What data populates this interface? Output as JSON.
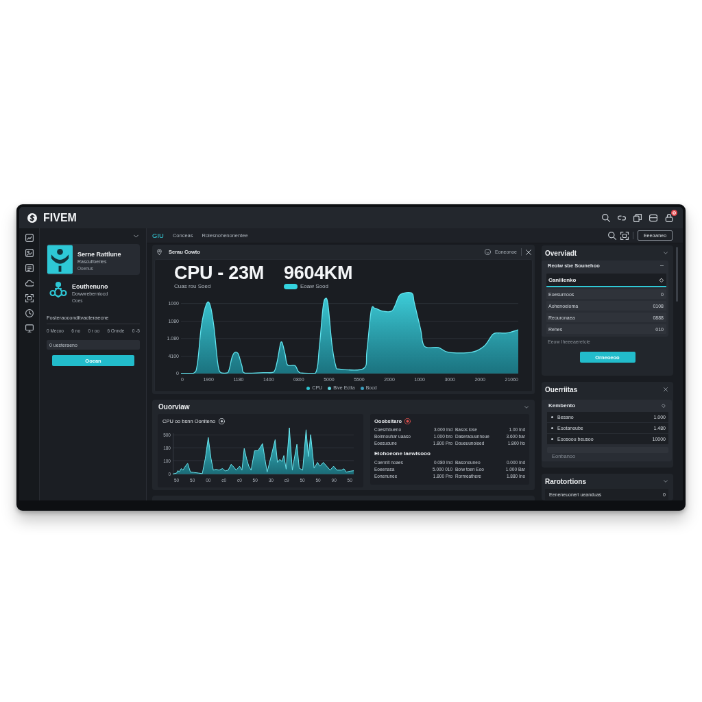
{
  "topbar": {
    "brand": "FIVEM",
    "alert": true
  },
  "left_panel": {
    "servers": [
      {
        "name": "Serne Rattlune",
        "detail": "Rasculfoeries",
        "status": "Ooenus",
        "selected": true
      },
      {
        "name": "Eouthenuno",
        "detail": "Dowwreberniocd",
        "status": "Ooes",
        "selected": false
      }
    ],
    "section_label": "Fosteraoconditvacteraecne",
    "stats": [
      "0 Mecoo",
      "6 no",
      "0 r oo",
      "6 Onnde",
      "0 -5"
    ],
    "search": {
      "placeholder": "0 uesteraeno"
    },
    "button": "Ooean"
  },
  "tabs": [
    {
      "label": "GIU",
      "selected": true
    },
    {
      "label": "Conceas",
      "selected": false
    },
    {
      "label": "Rolesnohenonentee",
      "selected": false
    }
  ],
  "toolbar": {
    "button": "Eeeowneo"
  },
  "main_chart": {
    "title": "Serau Cowto",
    "action": "Eoneonoe",
    "headline": "CPU - 23M",
    "headline_caption": "Cuas rou Soed",
    "metric": "9604KM",
    "metric_caption": "Eoaw Sood",
    "y_labels": [
      "1000",
      "1080",
      "1.080",
      "4100",
      "0"
    ],
    "x_labels": [
      "0",
      "1900",
      "1180",
      "1400",
      "0800",
      "5000",
      "5500",
      "2000",
      "1000",
      "3000",
      "2000",
      "21060"
    ],
    "legend": [
      {
        "label": "CPU",
        "color": "#2ec5d3"
      },
      {
        "label": "Bive Ectta",
        "color": "#5ed6df"
      },
      {
        "label": "Bocd",
        "color": "#3b9fbf"
      }
    ]
  },
  "overview": {
    "title": "Ouorviaw",
    "chart": {
      "title": "CPU oo bsnn Ooniteno",
      "y_labels": [
        "500",
        "180",
        "100",
        "0"
      ],
      "x_labels": [
        "50",
        "50",
        "00",
        "c0",
        "c0",
        "50",
        "30",
        "c9",
        "50",
        "50",
        "90",
        "50"
      ]
    },
    "stats": {
      "title": "Ooobsitaro",
      "sections": [
        {
          "rows": [
            [
              "Coesrhbueno",
              "3.000 Ind",
              "Basos lose",
              "1.00 Ind"
            ],
            [
              "Boinnouhar uaaso",
              "1.000 bro",
              "Daseraouunnoue",
              "3.600 bar"
            ],
            [
              "Eoesuoune",
              "1.800 Pro",
              "Doueuunoioed",
              "1.800 Ito"
            ]
          ]
        },
        {
          "heading": "Elohoeone Iaewlsooo",
          "rows": [
            [
              "Coennlt noaes",
              "0.080 Ind",
              "Basonouneo",
              "0.000 Ind"
            ],
            [
              "Eoeenasa",
              "5.000 010",
              "Boiw toen Eoo",
              "1.000 Bar"
            ],
            [
              "Eonenunee",
              "1.800 Pro",
              "Rormeathere",
              "1.880 Ino"
            ]
          ]
        }
      ]
    }
  },
  "side_overview": {
    "title": "Overviadt",
    "group": "Reoiw sbe Sounehoo",
    "items": [
      {
        "label": "Caniilenko",
        "value": "◇",
        "selected": true
      },
      {
        "label": "Eoesurnoos",
        "value": "0",
        "selected": false
      },
      {
        "label": "Aohenoeioma",
        "value": "0108",
        "selected": false
      },
      {
        "label": "Reouronaea",
        "value": "0888",
        "selected": false
      },
      {
        "label": "Rehes",
        "value": "010",
        "selected": false
      }
    ],
    "note": "Eeow Iheeeaeretcie",
    "button": "Orneoeoo"
  },
  "metrics_panel": {
    "title": "Ouerriitas",
    "group": "Kembento",
    "items": [
      {
        "label": "Besano",
        "value": "1.000"
      },
      {
        "label": "Eootanoube",
        "value": "1.480"
      },
      {
        "label": "Eoosoou beusoo",
        "value": "10000"
      }
    ],
    "note": "Eonbanoo"
  },
  "reports_panel": {
    "title": "Rarotortions",
    "items": [
      {
        "label": "Eeneneuoneri ueanduas",
        "value": "0"
      }
    ]
  }
}
